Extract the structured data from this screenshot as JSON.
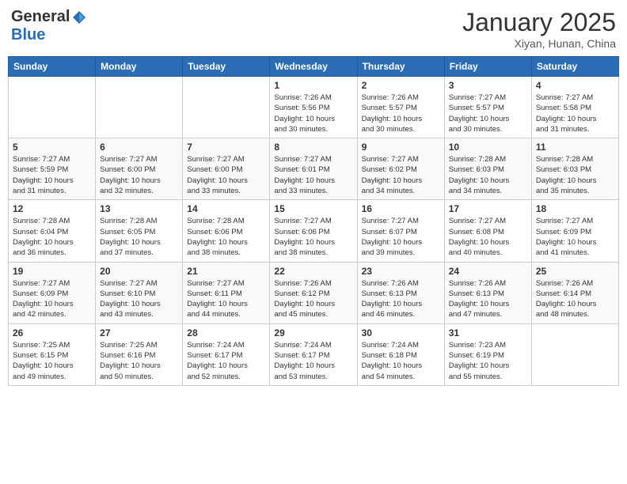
{
  "header": {
    "logo_general": "General",
    "logo_blue": "Blue",
    "month": "January 2025",
    "location": "Xiyan, Hunan, China"
  },
  "days_of_week": [
    "Sunday",
    "Monday",
    "Tuesday",
    "Wednesday",
    "Thursday",
    "Friday",
    "Saturday"
  ],
  "weeks": [
    {
      "days": [
        {
          "number": "",
          "info": ""
        },
        {
          "number": "",
          "info": ""
        },
        {
          "number": "",
          "info": ""
        },
        {
          "number": "1",
          "info": "Sunrise: 7:26 AM\nSunset: 5:56 PM\nDaylight: 10 hours\nand 30 minutes."
        },
        {
          "number": "2",
          "info": "Sunrise: 7:26 AM\nSunset: 5:57 PM\nDaylight: 10 hours\nand 30 minutes."
        },
        {
          "number": "3",
          "info": "Sunrise: 7:27 AM\nSunset: 5:57 PM\nDaylight: 10 hours\nand 30 minutes."
        },
        {
          "number": "4",
          "info": "Sunrise: 7:27 AM\nSunset: 5:58 PM\nDaylight: 10 hours\nand 31 minutes."
        }
      ]
    },
    {
      "days": [
        {
          "number": "5",
          "info": "Sunrise: 7:27 AM\nSunset: 5:59 PM\nDaylight: 10 hours\nand 31 minutes."
        },
        {
          "number": "6",
          "info": "Sunrise: 7:27 AM\nSunset: 6:00 PM\nDaylight: 10 hours\nand 32 minutes."
        },
        {
          "number": "7",
          "info": "Sunrise: 7:27 AM\nSunset: 6:00 PM\nDaylight: 10 hours\nand 33 minutes."
        },
        {
          "number": "8",
          "info": "Sunrise: 7:27 AM\nSunset: 6:01 PM\nDaylight: 10 hours\nand 33 minutes."
        },
        {
          "number": "9",
          "info": "Sunrise: 7:27 AM\nSunset: 6:02 PM\nDaylight: 10 hours\nand 34 minutes."
        },
        {
          "number": "10",
          "info": "Sunrise: 7:28 AM\nSunset: 6:03 PM\nDaylight: 10 hours\nand 34 minutes."
        },
        {
          "number": "11",
          "info": "Sunrise: 7:28 AM\nSunset: 6:03 PM\nDaylight: 10 hours\nand 35 minutes."
        }
      ]
    },
    {
      "days": [
        {
          "number": "12",
          "info": "Sunrise: 7:28 AM\nSunset: 6:04 PM\nDaylight: 10 hours\nand 36 minutes."
        },
        {
          "number": "13",
          "info": "Sunrise: 7:28 AM\nSunset: 6:05 PM\nDaylight: 10 hours\nand 37 minutes."
        },
        {
          "number": "14",
          "info": "Sunrise: 7:28 AM\nSunset: 6:06 PM\nDaylight: 10 hours\nand 38 minutes."
        },
        {
          "number": "15",
          "info": "Sunrise: 7:27 AM\nSunset: 6:06 PM\nDaylight: 10 hours\nand 38 minutes."
        },
        {
          "number": "16",
          "info": "Sunrise: 7:27 AM\nSunset: 6:07 PM\nDaylight: 10 hours\nand 39 minutes."
        },
        {
          "number": "17",
          "info": "Sunrise: 7:27 AM\nSunset: 6:08 PM\nDaylight: 10 hours\nand 40 minutes."
        },
        {
          "number": "18",
          "info": "Sunrise: 7:27 AM\nSunset: 6:09 PM\nDaylight: 10 hours\nand 41 minutes."
        }
      ]
    },
    {
      "days": [
        {
          "number": "19",
          "info": "Sunrise: 7:27 AM\nSunset: 6:09 PM\nDaylight: 10 hours\nand 42 minutes."
        },
        {
          "number": "20",
          "info": "Sunrise: 7:27 AM\nSunset: 6:10 PM\nDaylight: 10 hours\nand 43 minutes."
        },
        {
          "number": "21",
          "info": "Sunrise: 7:27 AM\nSunset: 6:11 PM\nDaylight: 10 hours\nand 44 minutes."
        },
        {
          "number": "22",
          "info": "Sunrise: 7:26 AM\nSunset: 6:12 PM\nDaylight: 10 hours\nand 45 minutes."
        },
        {
          "number": "23",
          "info": "Sunrise: 7:26 AM\nSunset: 6:13 PM\nDaylight: 10 hours\nand 46 minutes."
        },
        {
          "number": "24",
          "info": "Sunrise: 7:26 AM\nSunset: 6:13 PM\nDaylight: 10 hours\nand 47 minutes."
        },
        {
          "number": "25",
          "info": "Sunrise: 7:26 AM\nSunset: 6:14 PM\nDaylight: 10 hours\nand 48 minutes."
        }
      ]
    },
    {
      "days": [
        {
          "number": "26",
          "info": "Sunrise: 7:25 AM\nSunset: 6:15 PM\nDaylight: 10 hours\nand 49 minutes."
        },
        {
          "number": "27",
          "info": "Sunrise: 7:25 AM\nSunset: 6:16 PM\nDaylight: 10 hours\nand 50 minutes."
        },
        {
          "number": "28",
          "info": "Sunrise: 7:24 AM\nSunset: 6:17 PM\nDaylight: 10 hours\nand 52 minutes."
        },
        {
          "number": "29",
          "info": "Sunrise: 7:24 AM\nSunset: 6:17 PM\nDaylight: 10 hours\nand 53 minutes."
        },
        {
          "number": "30",
          "info": "Sunrise: 7:24 AM\nSunset: 6:18 PM\nDaylight: 10 hours\nand 54 minutes."
        },
        {
          "number": "31",
          "info": "Sunrise: 7:23 AM\nSunset: 6:19 PM\nDaylight: 10 hours\nand 55 minutes."
        },
        {
          "number": "",
          "info": ""
        }
      ]
    }
  ]
}
